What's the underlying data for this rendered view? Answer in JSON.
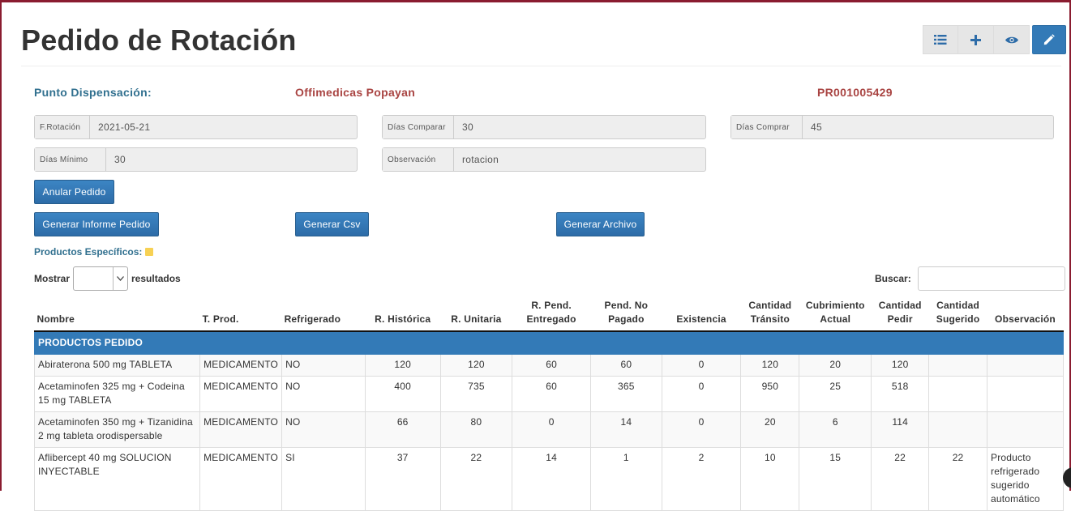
{
  "page": {
    "title": "Pedido de Rotación"
  },
  "toolbar": {
    "icons": [
      "list-icon",
      "plus-icon",
      "eye-icon",
      "pencil-icon"
    ],
    "active_color": "#337ab7"
  },
  "header_info": {
    "punto_label": "Punto Dispensación:",
    "punto_value": "Offimedicas Popayan",
    "pedido_code": "PR001005429"
  },
  "fields": {
    "f_rotacion": {
      "label": "F.Rotación",
      "value": "2021-05-21"
    },
    "dias_comparar": {
      "label": "Días Comparar",
      "value": "30"
    },
    "dias_comprar": {
      "label": "Días Comprar",
      "value": "45"
    },
    "dias_minimo": {
      "label": "Días Mínimo",
      "value": "30"
    },
    "observacion": {
      "label": "Observación",
      "value": "rotacion"
    }
  },
  "buttons": {
    "anular": "Anular Pedido",
    "informe": "Generar Informe Pedido",
    "csv": "Generar Csv",
    "archivo": "Generar Archivo"
  },
  "productos_especificos": {
    "label": "Productos Específicos:",
    "color": "#f7d154"
  },
  "table_controls": {
    "mostrar": "Mostrar",
    "resultados": "resultados",
    "buscar": "Buscar:"
  },
  "table": {
    "headers": {
      "nombre": "Nombre",
      "tprod": "T. Prod.",
      "refrigerado": "Refrigerado",
      "rhistorica": "R. Histórica",
      "runitaria": "R. Unitaria",
      "rpend_1": "R. Pend.",
      "rpend_2": "Entregado",
      "pendno_1": "Pend. No",
      "pendno_2": "Pagado",
      "existencia": "Existencia",
      "cant_transito_1": "Cantidad",
      "cant_transito_2": "Tránsito",
      "cubrimiento_1": "Cubrimiento",
      "cubrimiento_2": "Actual",
      "cant_pedir_1": "Cantidad",
      "cant_pedir_2": "Pedir",
      "cant_sugerido_1": "Cantidad",
      "cant_sugerido_2": "Sugerido",
      "observacion": "Observación"
    },
    "group_label": "PRODUCTOS PEDIDO",
    "rows": [
      {
        "nombre": "Abiraterona 500 mg TABLETA",
        "tprod": "MEDICAMENTO",
        "refrigerado": "NO",
        "rhistorica": "120",
        "runitaria": "120",
        "rpend": "60",
        "pendno": "60",
        "existencia": "0",
        "transito": "120",
        "cubrimiento": "20",
        "pedir": "120",
        "sugerido": "",
        "observacion": ""
      },
      {
        "nombre": "Acetaminofen 325 mg + Codeina 15 mg TABLETA",
        "tprod": "MEDICAMENTO",
        "refrigerado": "NO",
        "rhistorica": "400",
        "runitaria": "735",
        "rpend": "60",
        "pendno": "365",
        "existencia": "0",
        "transito": "950",
        "cubrimiento": "25",
        "pedir": "518",
        "sugerido": "",
        "observacion": ""
      },
      {
        "nombre": "Acetaminofen 350 mg + Tizanidina 2 mg tableta orodispersable",
        "tprod": "MEDICAMENTO",
        "refrigerado": "NO",
        "rhistorica": "66",
        "runitaria": "80",
        "rpend": "0",
        "pendno": "14",
        "existencia": "0",
        "transito": "20",
        "cubrimiento": "6",
        "pedir": "114",
        "sugerido": "",
        "observacion": ""
      },
      {
        "nombre": "Aflibercept 40 mg SOLUCION INYECTABLE",
        "tprod": "MEDICAMENTO",
        "refrigerado": "SI",
        "rhistorica": "37",
        "runitaria": "22",
        "rpend": "14",
        "pendno": "1",
        "existencia": "2",
        "transito": "10",
        "cubrimiento": "15",
        "pedir": "22",
        "sugerido": "22",
        "observacion": "Producto refrigerado sugerido automático"
      }
    ]
  }
}
